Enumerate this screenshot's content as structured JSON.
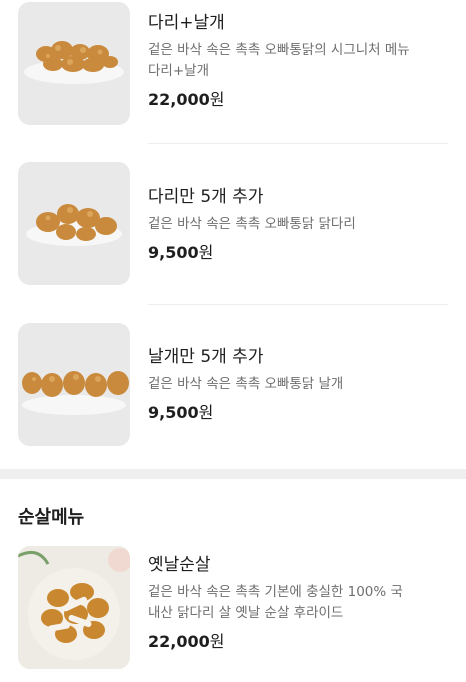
{
  "items": [
    {
      "name": "다리+날개",
      "desc_lines": [
        "겉은 바삭 속은 촉촉 오빠통닭의 시그니처 메뉴",
        "다리+날개"
      ],
      "price_num": "22,000",
      "price_unit": "원",
      "image": "fried-chicken-legs-wings-photo"
    },
    {
      "name": "다리만 5개 추가",
      "desc_lines": [
        "겉은 바삭 속은 촉촉 오빠통닭 닭다리"
      ],
      "price_num": "9,500",
      "price_unit": "원",
      "image": "fried-chicken-drumsticks-photo"
    },
    {
      "name": "날개만 5개 추가",
      "desc_lines": [
        "겉은 바삭 속은 촉촉 오빠통닭 날개"
      ],
      "price_num": "9,500",
      "price_unit": "원",
      "image": "fried-chicken-wings-photo"
    }
  ],
  "section": {
    "title": "순살메뉴",
    "items": [
      {
        "name": "옛날순살",
        "desc_lines": [
          "겉은 바삭 속은 촉촉 기본에 충실한 100% 국",
          "내산 닭다리 살 옛날 순살 후라이드"
        ],
        "price_num": "22,000",
        "price_unit": "원",
        "image": "boneless-chicken-photo"
      }
    ]
  },
  "colors": {
    "text": "#1e1e1e",
    "muted": "#6f6f6f",
    "divider": "#eeeeee",
    "section_gap": "#efefef",
    "fried": "#d49a4c"
  }
}
